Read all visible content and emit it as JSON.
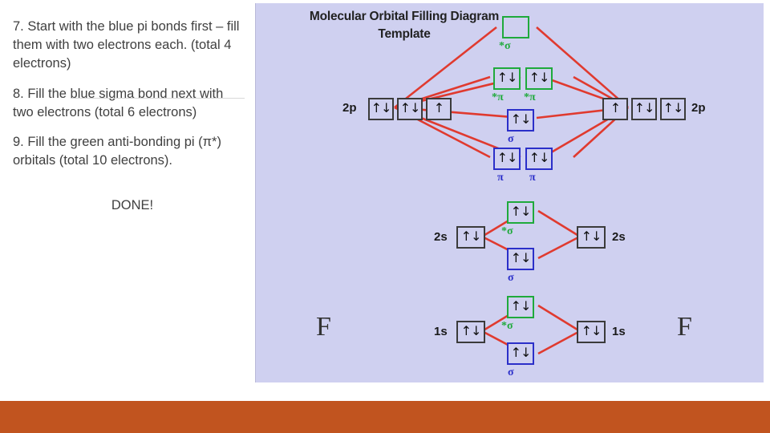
{
  "slide": {
    "paragraphs": [
      "7.  Start with the blue pi bonds first – fill them with two electrons each. (total 4 electrons)",
      "8.  Fill the blue sigma bond next with two electrons (total 6 electrons)",
      "9.  Fill the green anti-bonding pi (π*) orbitals (total 10 electrons)."
    ],
    "done_label": "DONE!"
  },
  "diagram": {
    "title_line1": "Molecular Orbital Filling Diagram",
    "title_line2": "Template",
    "atom_left": "F",
    "atom_right": "F",
    "shell_labels": {
      "left_2p": "2p",
      "right_2p": "2p",
      "left_2s": "2s",
      "right_2s": "2s",
      "left_1s": "1s",
      "right_1s": "1s"
    },
    "symbols": {
      "sigma_star": "*σ",
      "pi_star": "*π",
      "sigma": "σ",
      "pi": "π"
    },
    "colors": {
      "background": "#cfd0f0",
      "green": "#1faa3c",
      "blue": "#2b2fc9",
      "red": "#e03a2f",
      "box_black": "#3b3b3b"
    },
    "orbitals": {
      "left_2p": [
        "↑↓",
        "↑↓",
        "↑"
      ],
      "right_2p": [
        "↑",
        "↑↓",
        "↑↓"
      ],
      "left_2s": "↑↓",
      "right_2s": "↑↓",
      "left_1s": "↑↓",
      "right_1s": "↑↓",
      "mo_2p_sigma_star": "",
      "mo_2p_pi_star_1": "↑↓",
      "mo_2p_pi_star_2": "↑↓",
      "mo_2p_sigma": "↑↓",
      "mo_2p_pi_1": "↑↓",
      "mo_2p_pi_2": "↑↓",
      "mo_2s_sigma_star": "↑↓",
      "mo_2s_sigma": "↑↓",
      "mo_1s_sigma_star": "↑↓",
      "mo_1s_sigma": "↑↓"
    }
  }
}
